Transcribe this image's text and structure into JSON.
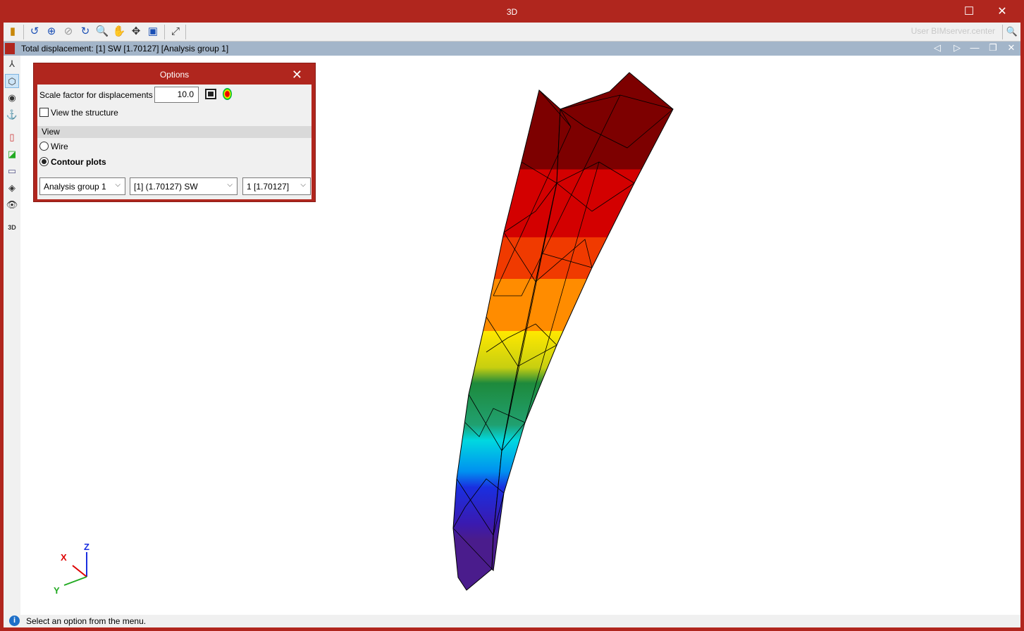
{
  "window": {
    "title": "3D",
    "maximize": "☐",
    "close": "✕"
  },
  "toolbar": {
    "user": "User BIMserver.center",
    "search": "🔍"
  },
  "document": {
    "title": "Total displacement: [1] SW [1.70127] [Analysis group 1]"
  },
  "options": {
    "title": "Options",
    "close": "✕",
    "scale_label": "Scale factor for displacements",
    "scale_value": "10.0",
    "view_structure": "View the structure",
    "view_structure_checked": false,
    "view_section": "View",
    "radio_wire": "Wire",
    "radio_contour": "Contour plots",
    "selected": "Contour plots",
    "select_group": "Analysis group 1",
    "select_load": "[1] (1.70127) SW",
    "select_mode": "1 [1.70127]"
  },
  "axes": {
    "x": "X",
    "y": "Y",
    "z": "Z"
  },
  "status": {
    "text": "Select an option from the menu."
  },
  "colors": {
    "frame": "#b0261e",
    "docbar": "#a3b5c9"
  }
}
